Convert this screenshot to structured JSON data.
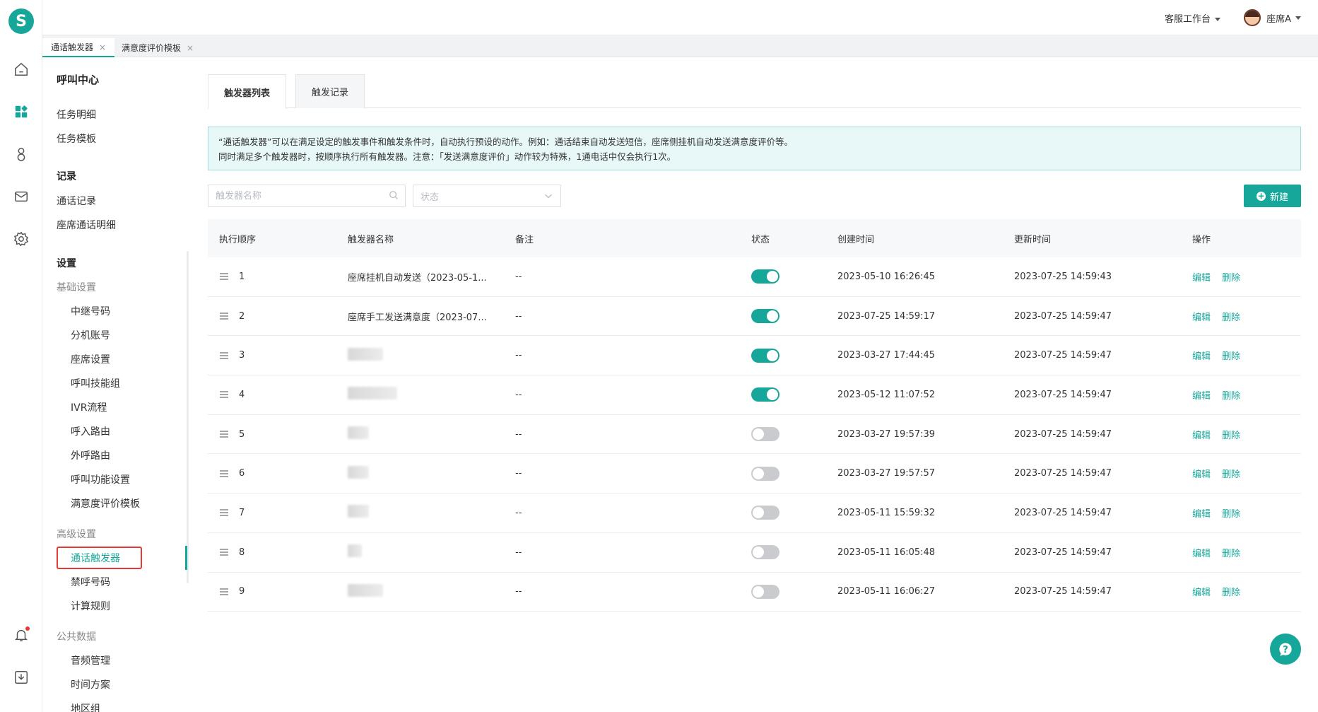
{
  "app": {
    "logo_letter": "S"
  },
  "topbar": {
    "workspace_label": "客服工作台",
    "user_name": "座席A"
  },
  "page_tabs": [
    {
      "label": "通话触发器",
      "close": "×"
    },
    {
      "label": "满意度评价模板",
      "close": "×"
    }
  ],
  "sidemenu": {
    "title": "呼叫中心",
    "task_items": [
      "任务明细",
      "任务模板"
    ],
    "record_group": "记录",
    "record_items": [
      "通话记录",
      "座席通话明细"
    ],
    "settings_group": "设置",
    "basic_sub": "基础设置",
    "basic_items": [
      "中继号码",
      "分机账号",
      "座席设置",
      "呼叫技能组",
      "IVR流程",
      "呼入路由",
      "外呼路由",
      "呼叫功能设置",
      "满意度评价模板"
    ],
    "advanced_sub": "高级设置",
    "advanced_items": [
      "通话触发器",
      "禁呼号码",
      "计算规则"
    ],
    "public_sub": "公共数据",
    "public_items": [
      "音频管理",
      "时间方案",
      "地区组"
    ]
  },
  "content_tabs": [
    "触发器列表",
    "触发记录"
  ],
  "notice": {
    "line1": "“通话触发器”可以在满足设定的触发事件和触发条件时，自动执行预设的动作。例如：通话结束自动发送短信，座席侧挂机自动发送满意度评价等。",
    "line2": "同时满足多个触发器时，按顺序执行所有触发器。注意：「发送满意度评价」动作较为特殊，1通电话中仅会执行1次。"
  },
  "filters": {
    "name_placeholder": "触发器名称",
    "status_placeholder": "状态"
  },
  "new_button": "新建",
  "table": {
    "headers": [
      "执行顺序",
      "触发器名称",
      "备注",
      "状态",
      "创建时间",
      "更新时间",
      "操作"
    ],
    "edit_label": "编辑",
    "delete_label": "删除",
    "rows": [
      {
        "order": "1",
        "name": "座席挂机自动发送（2023-05-1...",
        "remark": "--",
        "enabled": true,
        "created": "2023-05-10 16:26:45",
        "updated": "2023-07-25 14:59:43"
      },
      {
        "order": "2",
        "name": "座席手工发送满意度（2023-07...",
        "remark": "--",
        "enabled": true,
        "created": "2023-07-25 14:59:17",
        "updated": "2023-07-25 14:59:47"
      },
      {
        "order": "3",
        "name": "",
        "remark": "--",
        "enabled": true,
        "created": "2023-03-27 17:44:45",
        "updated": "2023-07-25 14:59:47"
      },
      {
        "order": "4",
        "name": "",
        "remark": "--",
        "enabled": true,
        "created": "2023-05-12 11:07:52",
        "updated": "2023-07-25 14:59:47"
      },
      {
        "order": "5",
        "name": "",
        "remark": "--",
        "enabled": false,
        "created": "2023-03-27 19:57:39",
        "updated": "2023-07-25 14:59:47"
      },
      {
        "order": "6",
        "name": "",
        "remark": "--",
        "enabled": false,
        "created": "2023-03-27 19:57:57",
        "updated": "2023-07-25 14:59:47"
      },
      {
        "order": "7",
        "name": "",
        "remark": "--",
        "enabled": false,
        "created": "2023-05-11 15:59:32",
        "updated": "2023-07-25 14:59:47"
      },
      {
        "order": "8",
        "name": "",
        "remark": "--",
        "enabled": false,
        "created": "2023-05-11 16:05:48",
        "updated": "2023-07-25 14:59:47"
      },
      {
        "order": "9",
        "name": "",
        "remark": "--",
        "enabled": false,
        "created": "2023-05-11 16:06:27",
        "updated": "2023-07-25 14:59:47"
      }
    ]
  },
  "colors": {
    "accent": "#17a79a",
    "highlight": "#e53935"
  },
  "icons": [
    "home-icon",
    "dashboard-icon",
    "contacts-icon",
    "mail-icon",
    "settings-icon",
    "bell-icon",
    "download-icon",
    "search-icon",
    "chevron-down-icon",
    "drag-handle-icon",
    "help-icon"
  ]
}
